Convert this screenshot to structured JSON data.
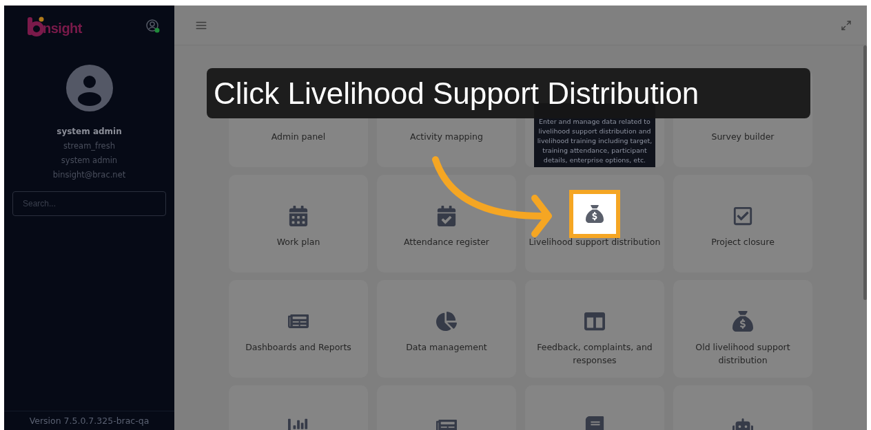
{
  "sidebar": {
    "logo": "nsight",
    "user": {
      "name": "system admin",
      "workspace": "stream_fresh",
      "role": "system admin",
      "email": "binsight@brac.net"
    },
    "search": {
      "placeholder": "Search..."
    },
    "version": "Version 7.5.0.7.325-brac-qa"
  },
  "cards": [
    {
      "label": "Admin panel",
      "highlighted": false
    },
    {
      "label": "Activity mapping",
      "highlighted": false
    },
    {
      "highlighted": false
    },
    {
      "label": "Survey builder",
      "highlighted": false
    },
    {
      "label": "Work plan",
      "highlighted": false
    },
    {
      "label": "Attendance register",
      "highlighted": false
    },
    {
      "label": "Livelihood support distribution",
      "highlighted": true
    },
    {
      "label": "Project closure",
      "highlighted": false
    },
    {
      "label": "Dashboards and Reports",
      "highlighted": false
    },
    {
      "label": "Data management",
      "highlighted": false
    },
    {
      "label": "Feedback, complaints, and responses",
      "highlighted": false
    },
    {
      "label": "Old livelihood support distribution",
      "highlighted": false
    },
    {
      "highlighted": false
    },
    {
      "highlighted": false
    },
    {
      "highlighted": false
    },
    {
      "highlighted": false
    }
  ],
  "tooltip": "Enter and manage data related to livelihood support distribution and livelihood training including target, training attendance, participant details, enterprise options, etc.",
  "caption": "Click Livelihood Support Distribution"
}
